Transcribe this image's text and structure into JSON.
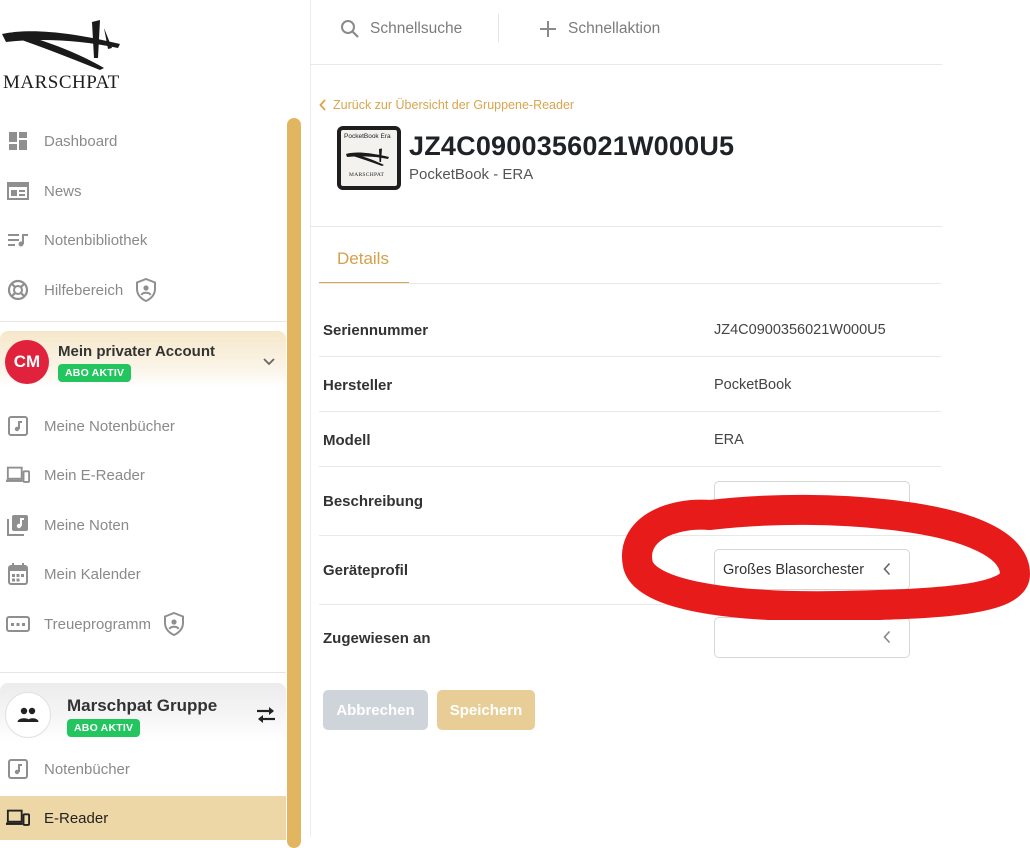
{
  "brand": {
    "name": "MARSCHPAT"
  },
  "sidebar": {
    "main_items": [
      {
        "label": "Dashboard",
        "icon": "dashboard-icon"
      },
      {
        "label": "News",
        "icon": "news-icon"
      },
      {
        "label": "Notenbibliothek",
        "icon": "playlist-icon"
      },
      {
        "label": "Hilfebereich",
        "icon": "lifebuoy-icon",
        "extra_icon": "shield-icon"
      }
    ],
    "account": {
      "initials": "CM",
      "name": "Mein privater Account",
      "badge": "ABO AKTIV",
      "items": [
        {
          "label": "Meine Notenbücher",
          "icon": "music-book-icon"
        },
        {
          "label": "Mein E-Reader",
          "icon": "devices-icon"
        },
        {
          "label": "Meine Noten",
          "icon": "music-library-icon"
        },
        {
          "label": "Mein Kalender",
          "icon": "calendar-icon"
        },
        {
          "label": "Treueprogramm",
          "icon": "loyalty-card-icon",
          "extra_icon": "shield-icon"
        }
      ]
    },
    "group": {
      "name": "Marschpat Gruppe",
      "badge": "ABO AKTIV",
      "items": [
        {
          "label": "Notenbücher",
          "icon": "music-book-icon"
        },
        {
          "label": "E-Reader",
          "icon": "devices-icon",
          "active": true
        }
      ]
    }
  },
  "topbar": {
    "search_label": "Schnellsuche",
    "action_label": "Schnellaktion"
  },
  "page": {
    "back_link": "Zurück zur Übersicht der Gruppene-Reader",
    "thumbnail": {
      "brand_text": "PocketBook Era",
      "logo_text": "MARSCHPAT"
    },
    "title": "JZ4C0900356021W000U5",
    "subtitle": "PocketBook - ERA",
    "tabs": [
      {
        "label": "Details",
        "active": true
      }
    ],
    "details": [
      {
        "label": "Seriennummer",
        "value": "JZ4C0900356021W000U5"
      },
      {
        "label": "Hersteller",
        "value": "PocketBook"
      },
      {
        "label": "Modell",
        "value": "ERA"
      },
      {
        "label": "Beschreibung",
        "value": ""
      },
      {
        "label": "Geräteprofil",
        "value": "Großes Blasorchester"
      },
      {
        "label": "Zugewiesen an",
        "value": ""
      }
    ],
    "cancel_label": "Abbrechen",
    "save_label": "Speichern"
  },
  "colors": {
    "accent": "#d9a94f",
    "active_nav": "#eed7a7",
    "badge_green": "#22c55e",
    "avatar_red": "#e0223c",
    "annotation_red": "#e81b1b"
  }
}
